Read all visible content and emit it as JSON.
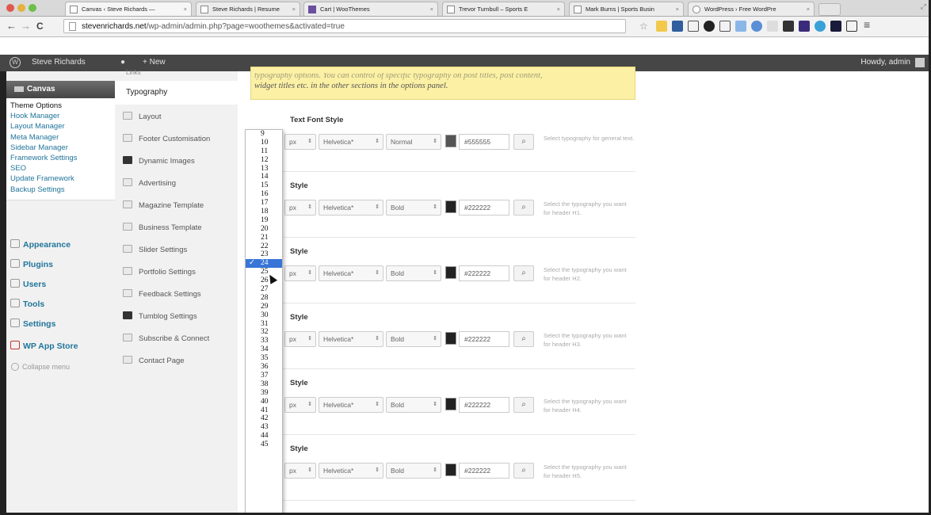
{
  "browser": {
    "tabs": [
      {
        "label": "Canvas ‹ Steve Richards — ",
        "favicon": "page",
        "active": true
      },
      {
        "label": "Steve Richards | Resume",
        "favicon": "page",
        "active": false
      },
      {
        "label": "Cart | WooThemes",
        "favicon": "woo",
        "active": false
      },
      {
        "label": "Trevor Turnbull – Sports E",
        "favicon": "page",
        "active": false
      },
      {
        "label": "Mark Burns | Sports Busin",
        "favicon": "page",
        "active": false
      },
      {
        "label": "WordPress › Free WordPre",
        "favicon": "wp",
        "active": false
      }
    ],
    "close_glyph": "×",
    "url_domain": "stevenrichards.net",
    "url_path": "/wp-admin/admin.php?page=woothemes&activated=true",
    "nav": {
      "back": "←",
      "forward": "→",
      "reload": "C"
    }
  },
  "adminbar": {
    "site_name": "Steve Richards",
    "comments_glyph": "●",
    "new_label": "+ New",
    "howdy": "Howdy, admin"
  },
  "wp_sidebar": {
    "canvas_label": "Canvas",
    "submenu": [
      "Theme Options",
      "Hook Manager",
      "Layout Manager",
      "Meta Manager",
      "Sidebar Manager",
      "Framework Settings",
      "SEO",
      "Update Framework",
      "Backup Settings"
    ],
    "menus": [
      "Appearance",
      "Plugins",
      "Users",
      "Tools",
      "Settings",
      "WP App Store"
    ],
    "collapse_label": "Collapse menu"
  },
  "options_nav": {
    "links_label": "Links",
    "current": "Typography",
    "items": [
      "Layout",
      "Footer Customisation",
      "Dynamic Images",
      "Advertising",
      "Magazine Template",
      "Business Template",
      "Slider Settings",
      "Portfolio Settings",
      "Feedback Settings",
      "Tumblog Settings",
      "Subscribe & Connect",
      "Contact Page"
    ]
  },
  "notice": {
    "line1": "typography options. You can control of specific typography on post titles, post content,",
    "line2": "widget titles etc. in the other sections in the options panel."
  },
  "rows": [
    {
      "title": "Text Font Style",
      "unit": "px",
      "font": "Helvetica*",
      "weight": "Normal",
      "color": "#555555",
      "desc": "Select typography for general text."
    },
    {
      "title": "Style",
      "unit": "px",
      "font": "Helvetica*",
      "weight": "Bold",
      "color": "#222222",
      "desc": "Select the typography you want for header H1."
    },
    {
      "title": "Style",
      "unit": "px",
      "font": "Helvetica*",
      "weight": "Bold",
      "color": "#222222",
      "desc": "Select the typography you want for header H2."
    },
    {
      "title": "Style",
      "unit": "px",
      "font": "Helvetica*",
      "weight": "Bold",
      "color": "#222222",
      "desc": "Select the typography you want for header H3."
    },
    {
      "title": "Style",
      "unit": "px",
      "font": "Helvetica*",
      "weight": "Bold",
      "color": "#222222",
      "desc": "Select the typography you want for header H4."
    },
    {
      "title": "Style",
      "unit": "px",
      "font": "Helvetica*",
      "weight": "Bold",
      "color": "#222222",
      "desc": "Select the typography you want for header H5."
    }
  ],
  "select_arrow": "⇕",
  "picker_glyph": "⌕",
  "font_size_dropdown": {
    "options": [
      "9",
      "10",
      "11",
      "12",
      "13",
      "14",
      "15",
      "16",
      "17",
      "18",
      "19",
      "20",
      "21",
      "22",
      "23",
      "24",
      "25",
      "26",
      "27",
      "28",
      "29",
      "30",
      "31",
      "32",
      "33",
      "34",
      "35",
      "36",
      "37",
      "38",
      "39",
      "40",
      "41",
      "42",
      "43",
      "44",
      "45"
    ],
    "selected": "24",
    "check_glyph": "✓"
  }
}
